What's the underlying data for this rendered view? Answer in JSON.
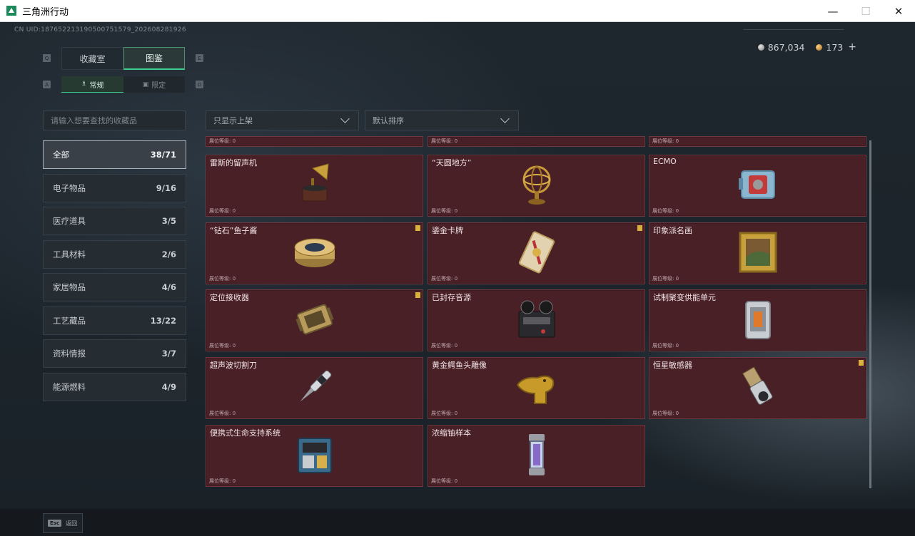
{
  "window": {
    "title": "三角洲行动"
  },
  "header": {
    "uid": "CN UID:187652213190500751579_202608281926",
    "currency": {
      "silver": "867,034",
      "gold": "173",
      "plus": "+"
    }
  },
  "tabs": {
    "main": [
      {
        "label": "收藏室",
        "key": "Q"
      },
      {
        "label": "图鉴",
        "key": "E"
      }
    ],
    "sub": [
      {
        "label": "常规",
        "key": "A"
      },
      {
        "label": "限定",
        "key": "D"
      }
    ]
  },
  "search": {
    "placeholder": "请输入想要查找的收藏品"
  },
  "filters": {
    "display": "只显示上架",
    "sort": "默认排序"
  },
  "categories": [
    {
      "label": "全部",
      "count": "38/71",
      "active": true
    },
    {
      "label": "电子物品",
      "count": "9/16"
    },
    {
      "label": "医疗道具",
      "count": "3/5"
    },
    {
      "label": "工具材料",
      "count": "2/6"
    },
    {
      "label": "家居物品",
      "count": "4/6"
    },
    {
      "label": "工艺藏品",
      "count": "13/22"
    },
    {
      "label": "资料情报",
      "count": "3/7"
    },
    {
      "label": "能源燃料",
      "count": "4/9"
    }
  ],
  "level_label": "展位等级: 0",
  "items": [
    {
      "name": "雷斯的留声机",
      "icon": "gramophone-icon",
      "flag": false
    },
    {
      "name": "“天圆地方”",
      "icon": "armillary-sphere-icon",
      "flag": false
    },
    {
      "name": "ECMO",
      "icon": "ecmo-machine-icon",
      "flag": false
    },
    {
      "name": "“钻石”鱼子酱",
      "icon": "caviar-tin-icon",
      "flag": true
    },
    {
      "name": "鎏金卡牌",
      "icon": "gilded-card-icon",
      "flag": true
    },
    {
      "name": "印象派名画",
      "icon": "framed-painting-icon",
      "flag": false
    },
    {
      "name": "定位接收器",
      "icon": "locator-receiver-icon",
      "flag": true
    },
    {
      "name": "已封存音源",
      "icon": "reel-recorder-icon",
      "flag": false
    },
    {
      "name": "试制聚变供能单元",
      "icon": "fusion-cell-icon",
      "flag": false
    },
    {
      "name": "超声波切割刀",
      "icon": "ultrasonic-cutter-icon",
      "flag": false
    },
    {
      "name": "黄金鳄鱼头雕像",
      "icon": "gold-crocodile-icon",
      "flag": false
    },
    {
      "name": "恒星敏感器",
      "icon": "star-sensor-icon",
      "flag": true
    },
    {
      "name": "便携式生命支持系统",
      "icon": "life-support-icon",
      "flag": false
    },
    {
      "name": "浓缩铀样本",
      "icon": "uranium-capsule-icon",
      "flag": false
    }
  ],
  "footer": {
    "esc_key": "Esc",
    "back_label": "返回"
  }
}
